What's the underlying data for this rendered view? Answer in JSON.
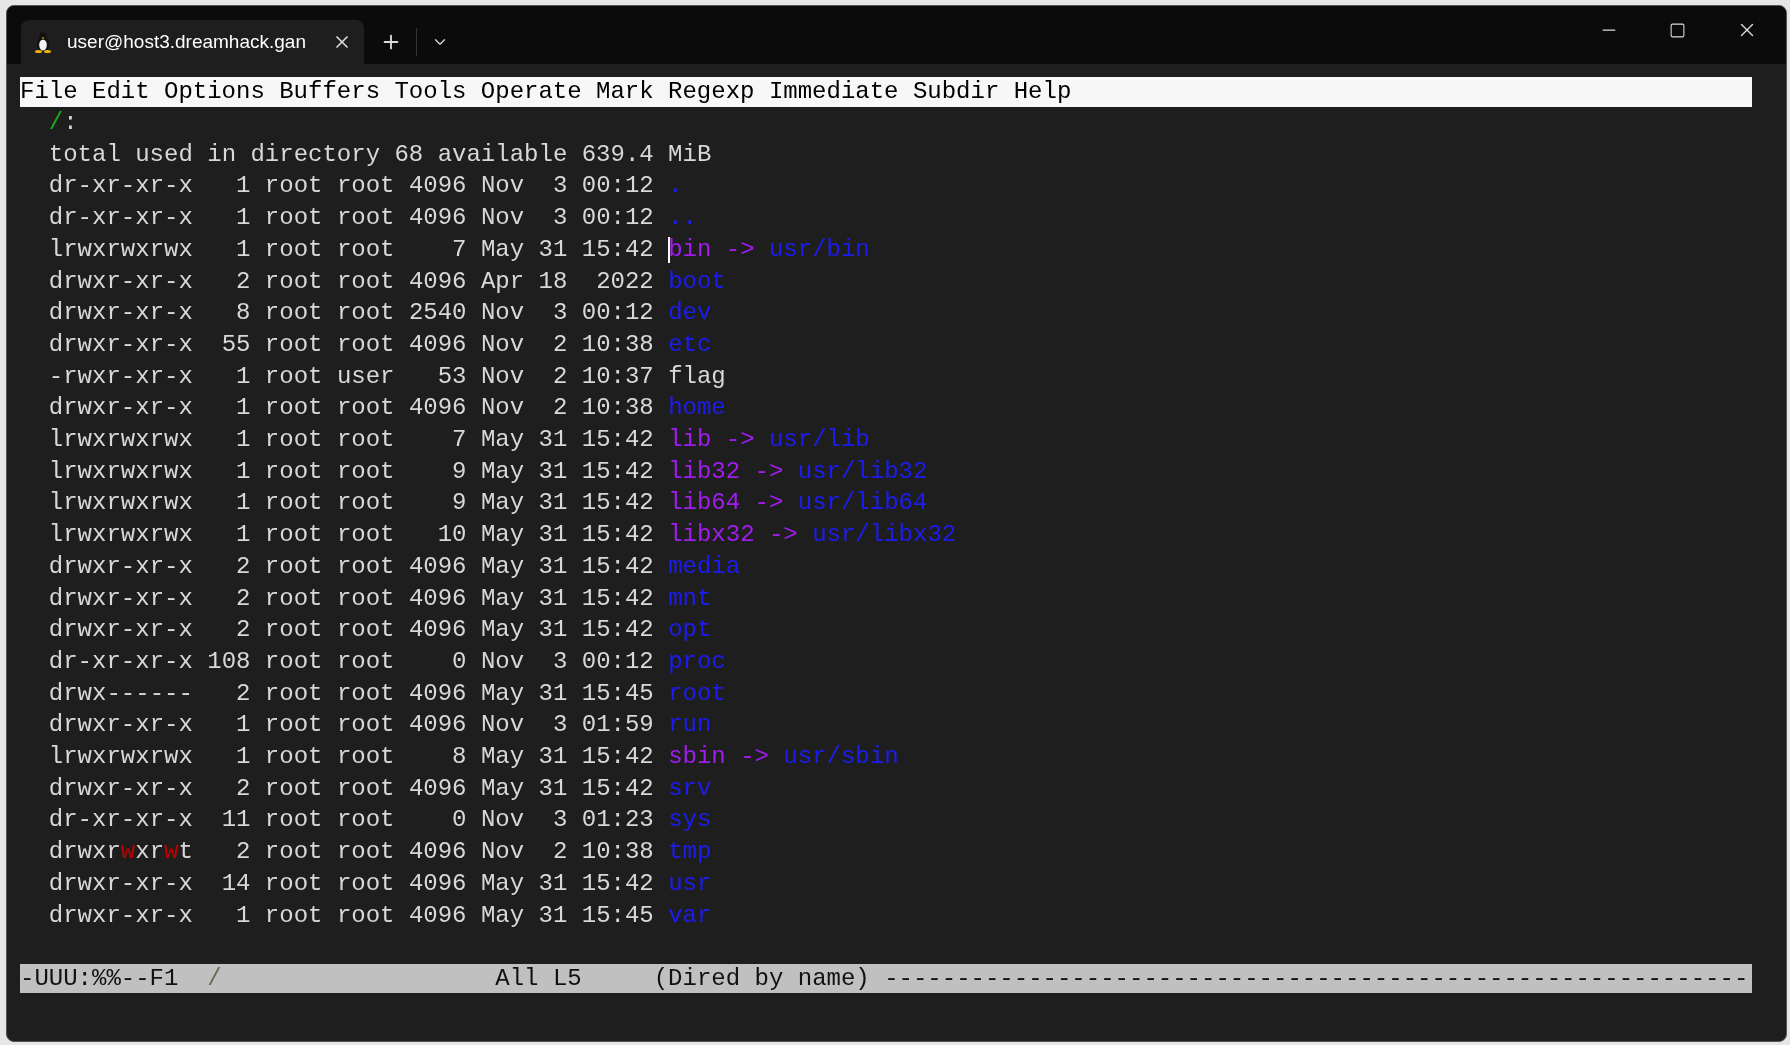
{
  "window": {
    "tab": {
      "title": "user@host3.dreamhack.gan"
    }
  },
  "menu": [
    "File",
    "Edit",
    "Options",
    "Buffers",
    "Tools",
    "Operate",
    "Mark",
    "Regexp",
    "Immediate",
    "Subdir",
    "Help"
  ],
  "header": {
    "path": "/",
    "suffix": ":"
  },
  "total": "total used in directory 68 available 639.4 MiB",
  "rows": [
    {
      "perms": "dr-xr-xr-x",
      "other_writable": false,
      "links": "1",
      "user": "root",
      "group": "root",
      "size": "4096",
      "month": "Nov",
      "day": "3",
      "time": "00:12",
      "name": ".",
      "kind": "dir",
      "cursor": false
    },
    {
      "perms": "dr-xr-xr-x",
      "other_writable": false,
      "links": "1",
      "user": "root",
      "group": "root",
      "size": "4096",
      "month": "Nov",
      "day": "3",
      "time": "00:12",
      "name": "..",
      "kind": "dir",
      "cursor": false
    },
    {
      "perms": "lrwxrwxrwx",
      "other_writable": false,
      "links": "1",
      "user": "root",
      "group": "root",
      "size": "7",
      "month": "May",
      "day": "31",
      "time": "15:42",
      "name": "bin",
      "kind": "link",
      "arrow": "->",
      "target": "usr/bin",
      "cursor": true
    },
    {
      "perms": "drwxr-xr-x",
      "other_writable": false,
      "links": "2",
      "user": "root",
      "group": "root",
      "size": "4096",
      "month": "Apr",
      "day": "18",
      "time": "2022",
      "name": "boot",
      "kind": "dir",
      "cursor": false
    },
    {
      "perms": "drwxr-xr-x",
      "other_writable": false,
      "links": "8",
      "user": "root",
      "group": "root",
      "size": "2540",
      "month": "Nov",
      "day": "3",
      "time": "00:12",
      "name": "dev",
      "kind": "dir",
      "cursor": false
    },
    {
      "perms": "drwxr-xr-x",
      "other_writable": false,
      "links": "55",
      "user": "root",
      "group": "root",
      "size": "4096",
      "month": "Nov",
      "day": "2",
      "time": "10:38",
      "name": "etc",
      "kind": "dir",
      "cursor": false
    },
    {
      "perms": "-rwxr-xr-x",
      "other_writable": false,
      "links": "1",
      "user": "root",
      "group": "user",
      "size": "53",
      "month": "Nov",
      "day": "2",
      "time": "10:37",
      "name": "flag",
      "kind": "file",
      "cursor": false
    },
    {
      "perms": "drwxr-xr-x",
      "other_writable": false,
      "links": "1",
      "user": "root",
      "group": "root",
      "size": "4096",
      "month": "Nov",
      "day": "2",
      "time": "10:38",
      "name": "home",
      "kind": "dir",
      "cursor": false
    },
    {
      "perms": "lrwxrwxrwx",
      "other_writable": false,
      "links": "1",
      "user": "root",
      "group": "root",
      "size": "7",
      "month": "May",
      "day": "31",
      "time": "15:42",
      "name": "lib",
      "kind": "link",
      "arrow": "->",
      "target": "usr/lib",
      "cursor": false
    },
    {
      "perms": "lrwxrwxrwx",
      "other_writable": false,
      "links": "1",
      "user": "root",
      "group": "root",
      "size": "9",
      "month": "May",
      "day": "31",
      "time": "15:42",
      "name": "lib32",
      "kind": "link",
      "arrow": "->",
      "target": "usr/lib32",
      "cursor": false
    },
    {
      "perms": "lrwxrwxrwx",
      "other_writable": false,
      "links": "1",
      "user": "root",
      "group": "root",
      "size": "9",
      "month": "May",
      "day": "31",
      "time": "15:42",
      "name": "lib64",
      "kind": "link",
      "arrow": "->",
      "target": "usr/lib64",
      "cursor": false
    },
    {
      "perms": "lrwxrwxrwx",
      "other_writable": false,
      "links": "1",
      "user": "root",
      "group": "root",
      "size": "10",
      "month": "May",
      "day": "31",
      "time": "15:42",
      "name": "libx32",
      "kind": "link",
      "arrow": "->",
      "target": "usr/libx32",
      "cursor": false
    },
    {
      "perms": "drwxr-xr-x",
      "other_writable": false,
      "links": "2",
      "user": "root",
      "group": "root",
      "size": "4096",
      "month": "May",
      "day": "31",
      "time": "15:42",
      "name": "media",
      "kind": "dir",
      "cursor": false
    },
    {
      "perms": "drwxr-xr-x",
      "other_writable": false,
      "links": "2",
      "user": "root",
      "group": "root",
      "size": "4096",
      "month": "May",
      "day": "31",
      "time": "15:42",
      "name": "mnt",
      "kind": "dir",
      "cursor": false
    },
    {
      "perms": "drwxr-xr-x",
      "other_writable": false,
      "links": "2",
      "user": "root",
      "group": "root",
      "size": "4096",
      "month": "May",
      "day": "31",
      "time": "15:42",
      "name": "opt",
      "kind": "dir",
      "cursor": false
    },
    {
      "perms": "dr-xr-xr-x",
      "other_writable": false,
      "links": "108",
      "user": "root",
      "group": "root",
      "size": "0",
      "month": "Nov",
      "day": "3",
      "time": "00:12",
      "name": "proc",
      "kind": "dir",
      "cursor": false
    },
    {
      "perms": "drwx------",
      "other_writable": false,
      "links": "2",
      "user": "root",
      "group": "root",
      "size": "4096",
      "month": "May",
      "day": "31",
      "time": "15:45",
      "name": "root",
      "kind": "dir",
      "cursor": false
    },
    {
      "perms": "drwxr-xr-x",
      "other_writable": false,
      "links": "1",
      "user": "root",
      "group": "root",
      "size": "4096",
      "month": "Nov",
      "day": "3",
      "time": "01:59",
      "name": "run",
      "kind": "dir",
      "cursor": false
    },
    {
      "perms": "lrwxrwxrwx",
      "other_writable": false,
      "links": "1",
      "user": "root",
      "group": "root",
      "size": "8",
      "month": "May",
      "day": "31",
      "time": "15:42",
      "name": "sbin",
      "kind": "link",
      "arrow": "->",
      "target": "usr/sbin",
      "cursor": false
    },
    {
      "perms": "drwxr-xr-x",
      "other_writable": false,
      "links": "2",
      "user": "root",
      "group": "root",
      "size": "4096",
      "month": "May",
      "day": "31",
      "time": "15:42",
      "name": "srv",
      "kind": "dir",
      "cursor": false
    },
    {
      "perms": "dr-xr-xr-x",
      "other_writable": false,
      "links": "11",
      "user": "root",
      "group": "root",
      "size": "0",
      "month": "Nov",
      "day": "3",
      "time": "01:23",
      "name": "sys",
      "kind": "dir",
      "cursor": false
    },
    {
      "perms": "drwxrwxrwt",
      "other_writable": true,
      "links": "2",
      "user": "root",
      "group": "root",
      "size": "4096",
      "month": "Nov",
      "day": "2",
      "time": "10:38",
      "name": "tmp",
      "kind": "dir",
      "cursor": false
    },
    {
      "perms": "drwxr-xr-x",
      "other_writable": false,
      "links": "14",
      "user": "root",
      "group": "root",
      "size": "4096",
      "month": "May",
      "day": "31",
      "time": "15:42",
      "name": "usr",
      "kind": "dir",
      "cursor": false
    },
    {
      "perms": "drwxr-xr-x",
      "other_writable": false,
      "links": "1",
      "user": "root",
      "group": "root",
      "size": "4096",
      "month": "May",
      "day": "31",
      "time": "15:45",
      "name": "var",
      "kind": "dir",
      "cursor": false
    }
  ],
  "mode_line": {
    "status": "-UUU:%%--F1",
    "buffer": "/",
    "position": "All L5",
    "mode": "(Dired by name)",
    "fill": "------------------------------------------------------------"
  }
}
